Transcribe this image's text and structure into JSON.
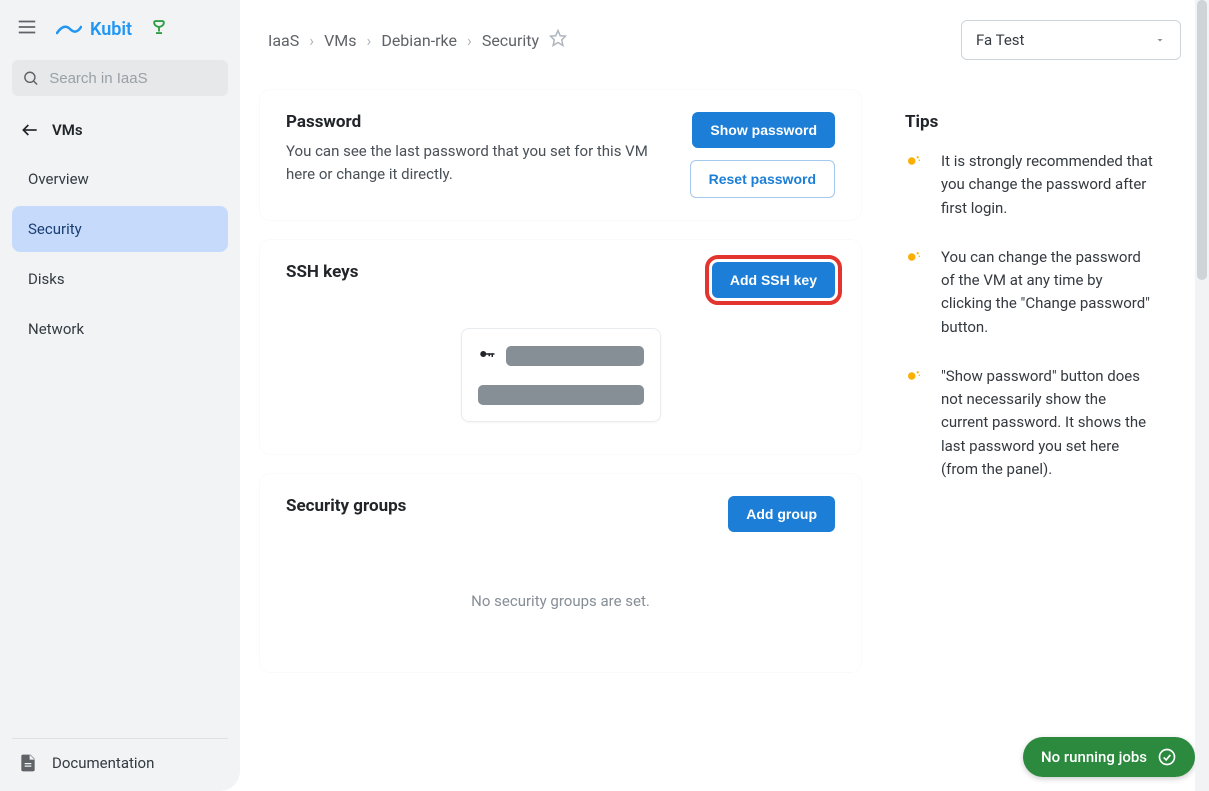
{
  "brand": {
    "name": "Kubit"
  },
  "search": {
    "placeholder": "Search in IaaS"
  },
  "sidebar": {
    "back_label": "VMs",
    "items": [
      {
        "label": "Overview"
      },
      {
        "label": "Security"
      },
      {
        "label": "Disks"
      },
      {
        "label": "Network"
      }
    ],
    "doc_label": "Documentation"
  },
  "breadcrumbs": [
    "IaaS",
    "VMs",
    "Debian-rke",
    "Security"
  ],
  "org": {
    "selected": "Fa Test"
  },
  "password_card": {
    "title": "Password",
    "desc": "You can see the last password that you set for this VM here or change it directly.",
    "show_btn": "Show password",
    "reset_btn": "Reset password"
  },
  "ssh_card": {
    "title": "SSH keys",
    "add_btn": "Add SSH key"
  },
  "sg_card": {
    "title": "Security groups",
    "add_btn": "Add group",
    "empty": "No security groups are set."
  },
  "tips": {
    "title": "Tips",
    "items": [
      "It is strongly recommended that you change the password after first login.",
      "You can change the password of the VM at any time by clicking the \"Change password\" button.",
      "\"Show password\" button does not necessarily show the current password. It shows the last password you set here (from the panel)."
    ]
  },
  "jobs": {
    "label": "No running jobs"
  }
}
